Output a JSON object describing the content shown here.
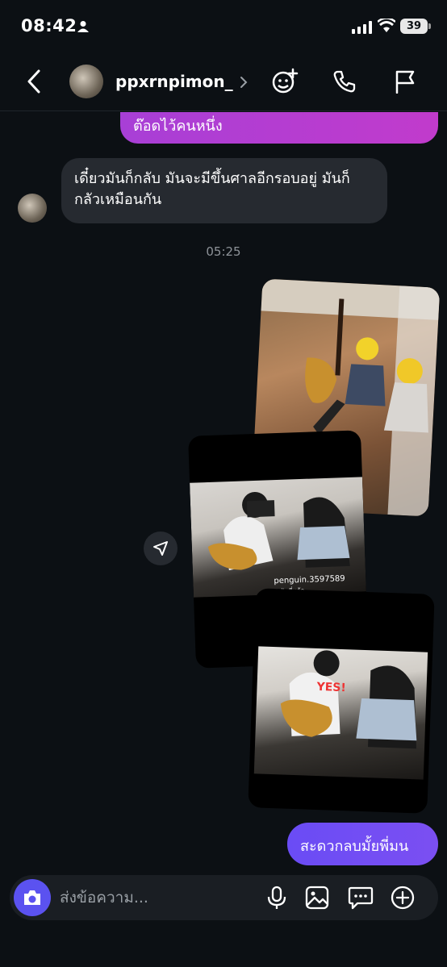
{
  "status_bar": {
    "time": "08:42",
    "battery": "39"
  },
  "header": {
    "username": "ppxrnpimon_"
  },
  "messages": {
    "sent_partial": "ต๊อดไว้คนหนึ่ง",
    "received": "เดี๋ยวมันก็กลับ มันจะมีขึ้นศาลอีกรอบอยู่ มันก็กลัวเหมือนกัน",
    "timestamp": "05:25",
    "photo_shared_user": "penguin.3597589",
    "photo_shared_time": "5 วันที่แล้ว",
    "photo_text": "YES!",
    "sent_last": "สะดวกลบมั้ยพี่มน"
  },
  "composer": {
    "placeholder": "ส่งข้อความ..."
  }
}
